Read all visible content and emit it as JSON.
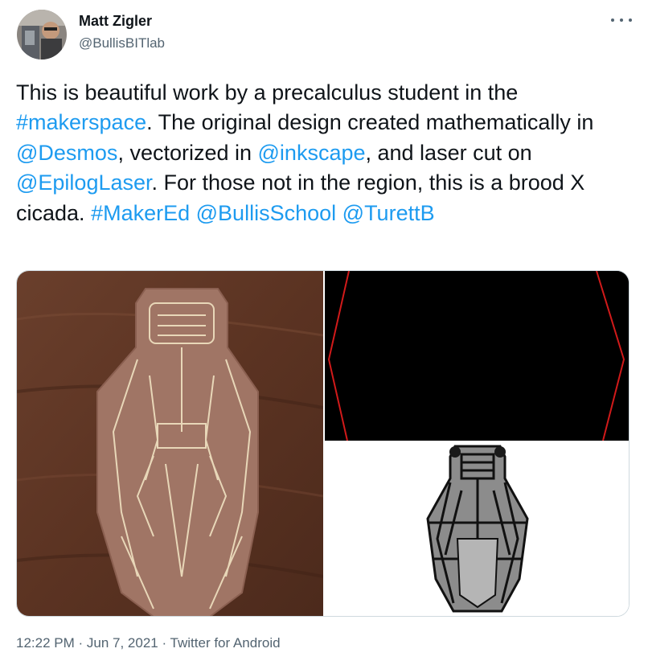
{
  "author": {
    "name": "Matt Zigler",
    "handle": "@BullisBITlab"
  },
  "tweet": {
    "segments": [
      {
        "text": "This is beautiful work by a precalculus student in the ",
        "link": false
      },
      {
        "text": "#makerspace",
        "link": true
      },
      {
        "text": ". The original design created mathematically in ",
        "link": false
      },
      {
        "text": "@Desmos",
        "link": true
      },
      {
        "text": ", vectorized in ",
        "link": false
      },
      {
        "text": "@inkscape",
        "link": true
      },
      {
        "text": ", and laser cut on ",
        "link": false
      },
      {
        "text": "@EpilogLaser",
        "link": true
      },
      {
        "text": ". For those not in the region, this is a brood X cicada. ",
        "link": false
      },
      {
        "text": "#MakerEd",
        "link": true
      },
      {
        "text": " ",
        "link": false
      },
      {
        "text": "@BullisSchool",
        "link": true
      },
      {
        "text": " ",
        "link": false
      },
      {
        "text": "@TurettB",
        "link": true
      }
    ]
  },
  "meta": {
    "time": "12:22 PM",
    "date": "Jun 7, 2021",
    "source": "Twitter for Android",
    "separator": " · "
  },
  "colors": {
    "link": "#1d9bf0",
    "secondary": "#536471",
    "text": "#0f1419"
  },
  "icons": {
    "more": "more-horizontal-icon"
  }
}
